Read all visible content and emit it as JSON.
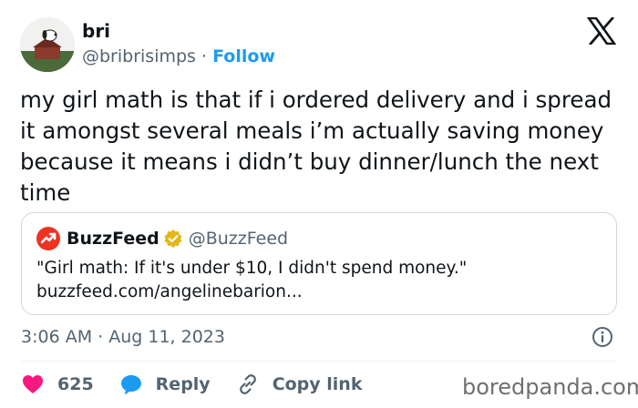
{
  "author": {
    "name": "bri",
    "handle": "@bribrisimps",
    "separator": " · ",
    "follow_label": "Follow",
    "avatar_icon": "snoopy-avatar"
  },
  "platform_icon": "x-logo-icon",
  "tweet": {
    "text": "my girl math is that if i ordered delivery and i spread it amongst several meals i’m actually saving money because it means i didn’t buy dinner/lunch the next time"
  },
  "quote": {
    "name": "BuzzFeed",
    "handle": "@BuzzFeed",
    "text_line1": "\"Girl math: If it's under $10, I didn't spend money.\"",
    "text_line2": "buzzfeed.com/angelinebarion..."
  },
  "timestamp": "3:06 AM · Aug 11, 2023",
  "actions": {
    "like_count": "625",
    "reply_label": "Reply",
    "copy_link_label": "Copy link"
  },
  "watermark": "boredpanda.com",
  "colors": {
    "accent": "#1d9bf0",
    "heart": "#f91880",
    "secondary_text": "#536471",
    "buzzfeed_red": "#ee3322",
    "verified_gold": "#e2b719"
  }
}
